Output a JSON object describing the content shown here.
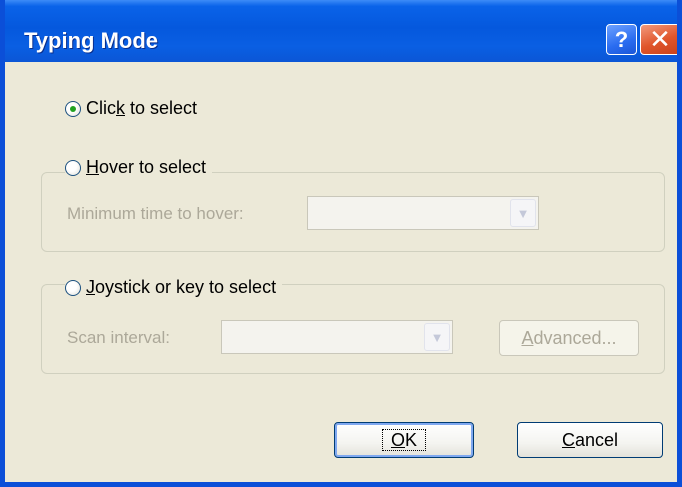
{
  "dialog": {
    "title": "Typing Mode",
    "help_icon": "help-question-icon",
    "close_icon": "close-x-icon",
    "colors": {
      "titlebar": "#0558DD",
      "body": "#ECE9D8",
      "close": "#E0552B",
      "radio_dot": "#21A121",
      "disabled_text": "#ACA899"
    }
  },
  "options": {
    "click": {
      "pre": "Clic",
      "mnemonic": "k",
      "post": " to select",
      "checked": true
    },
    "hover": {
      "pre": "",
      "mnemonic": "H",
      "post": "over to select",
      "checked": false
    },
    "joystick": {
      "pre": "",
      "mnemonic": "J",
      "post": "oystick or key to select",
      "checked": false
    }
  },
  "hover_group": {
    "label": "Minimum time to hover:",
    "value": ""
  },
  "joystick_group": {
    "label": "Scan interval:",
    "value": "",
    "advanced": {
      "mnemonic": "A",
      "rest": "dvanced..."
    }
  },
  "buttons": {
    "ok": {
      "mnemonic": "O",
      "rest": "K"
    },
    "cancel": {
      "mnemonic": "C",
      "rest": "ancel"
    }
  }
}
